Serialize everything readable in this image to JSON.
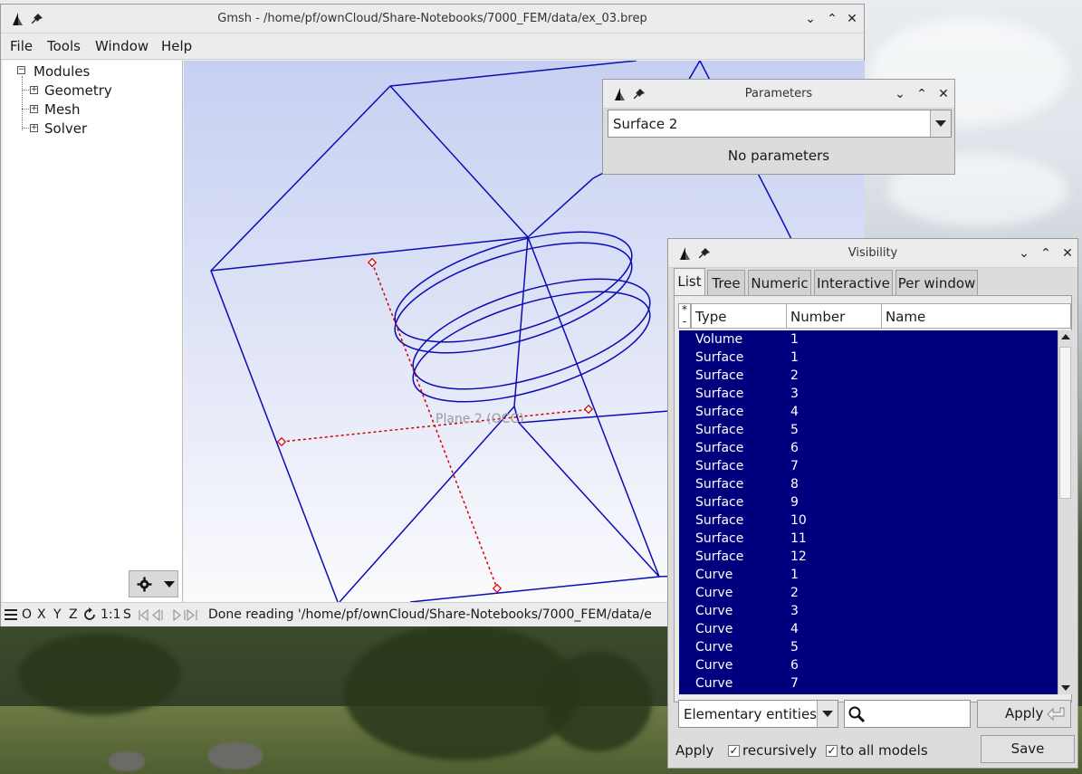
{
  "main_window": {
    "title": "Gmsh - /home/pf/ownCloud/Share-Notebooks/7000_FEM/data/ex_03.brep",
    "menu": [
      "File",
      "Tools",
      "Window",
      "Help"
    ],
    "tree": {
      "root": "Modules",
      "children": [
        "Geometry",
        "Mesh",
        "Solver"
      ]
    },
    "viewport": {
      "label": "Plane 2 (OCC)",
      "geometry_color": "#0b0bb8",
      "plane_color": "#d40000",
      "background_top": "#c7d0f2",
      "background_bottom": "#fbfbfd"
    },
    "statusbar": {
      "axes": [
        "O",
        "X",
        "Y",
        "Z"
      ],
      "scale": "1:1",
      "s": "S",
      "message": "Done reading '/home/pf/ownCloud/Share-Notebooks/7000_FEM/data/e"
    }
  },
  "parameters_window": {
    "title": "Parameters",
    "selected": "Surface 2",
    "message": "No parameters"
  },
  "visibility_window": {
    "title": "Visibility",
    "tabs": [
      "List",
      "Tree",
      "Numeric",
      "Interactive",
      "Per window"
    ],
    "active_tab": "List",
    "star": "*",
    "dash": "-",
    "columns": [
      "Type",
      "Number",
      "Name"
    ],
    "rows": [
      {
        "type": "Volume",
        "number": "1"
      },
      {
        "type": "Surface",
        "number": "1"
      },
      {
        "type": "Surface",
        "number": "2"
      },
      {
        "type": "Surface",
        "number": "3"
      },
      {
        "type": "Surface",
        "number": "4"
      },
      {
        "type": "Surface",
        "number": "5"
      },
      {
        "type": "Surface",
        "number": "6"
      },
      {
        "type": "Surface",
        "number": "7"
      },
      {
        "type": "Surface",
        "number": "8"
      },
      {
        "type": "Surface",
        "number": "9"
      },
      {
        "type": "Surface",
        "number": "10"
      },
      {
        "type": "Surface",
        "number": "11"
      },
      {
        "type": "Surface",
        "number": "12"
      },
      {
        "type": "Curve",
        "number": "1"
      },
      {
        "type": "Curve",
        "number": "2"
      },
      {
        "type": "Curve",
        "number": "3"
      },
      {
        "type": "Curve",
        "number": "4"
      },
      {
        "type": "Curve",
        "number": "5"
      },
      {
        "type": "Curve",
        "number": "6"
      },
      {
        "type": "Curve",
        "number": "7"
      }
    ],
    "entity_select": "Elementary entities",
    "search_value": "",
    "apply_button": "Apply",
    "apply_label": "Apply",
    "recursively_label": "recursively",
    "recursively_checked": true,
    "all_models_label": "to all models",
    "all_models_checked": true,
    "save_button": "Save",
    "selection_color": "#00007e"
  }
}
